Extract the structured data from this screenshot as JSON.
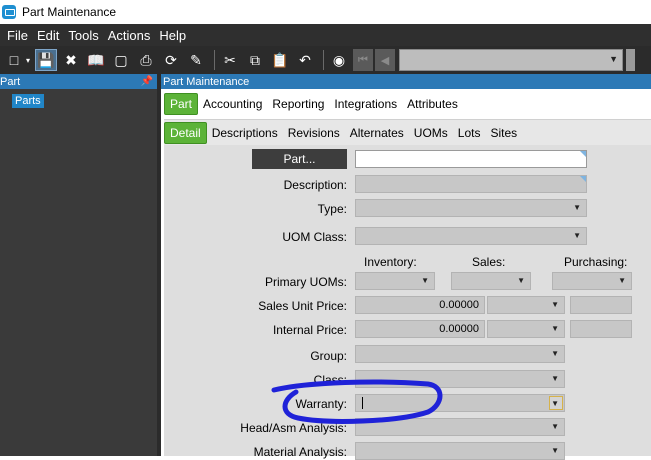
{
  "window": {
    "title": "Part Maintenance",
    "icon": "app-window-icon"
  },
  "menu": [
    "File",
    "Edit",
    "Tools",
    "Actions",
    "Help"
  ],
  "toolbar": {
    "icons": [
      "new-icon",
      "save-icon",
      "delete-icon",
      "open-book-icon",
      "clear-icon",
      "print-icon",
      "refresh-icon",
      "sweep-icon",
      "cut-icon",
      "copy-icon",
      "paste-icon",
      "undo-icon",
      "search-binoculars-icon",
      "first-record-icon",
      "previous-record-icon"
    ],
    "record_value": ""
  },
  "left_panel": {
    "header": "Part",
    "pin_icon": "pin-icon",
    "tree": [
      "Parts"
    ]
  },
  "main": {
    "header": "Part Maintenance",
    "tabs_top": [
      "Part",
      "Accounting",
      "Reporting",
      "Integrations",
      "Attributes"
    ],
    "tabs_top_selected": "Part",
    "tabs_sub": [
      "Detail",
      "Descriptions",
      "Revisions",
      "Alternates",
      "UOMs",
      "Lots",
      "Sites"
    ],
    "tabs_sub_selected": "Detail"
  },
  "form": {
    "part_button": "Part...",
    "part_value": "",
    "description_label": "Description:",
    "type_label": "Type:",
    "uom_class_label": "UOM Class:",
    "col_inventory": "Inventory:",
    "col_sales": "Sales:",
    "col_purchasing": "Purchasing:",
    "primary_uoms_label": "Primary UOMs:",
    "sales_unit_price_label": "Sales Unit Price:",
    "sales_unit_price_value": "0.00000",
    "internal_price_label": "Internal Price:",
    "internal_price_value": "0.00000",
    "group_label": "Group:",
    "class_label": "Class:",
    "warranty_label": "Warranty:",
    "warranty_value": "",
    "head_asm_label": "Head/Asm Analysis:",
    "material_label": "Material Analysis:"
  },
  "colors": {
    "menu_bg": "#2f2f2f",
    "header_blue": "#2c79b6",
    "tab_green": "#5cb338",
    "annotation": "#1f22d8"
  }
}
